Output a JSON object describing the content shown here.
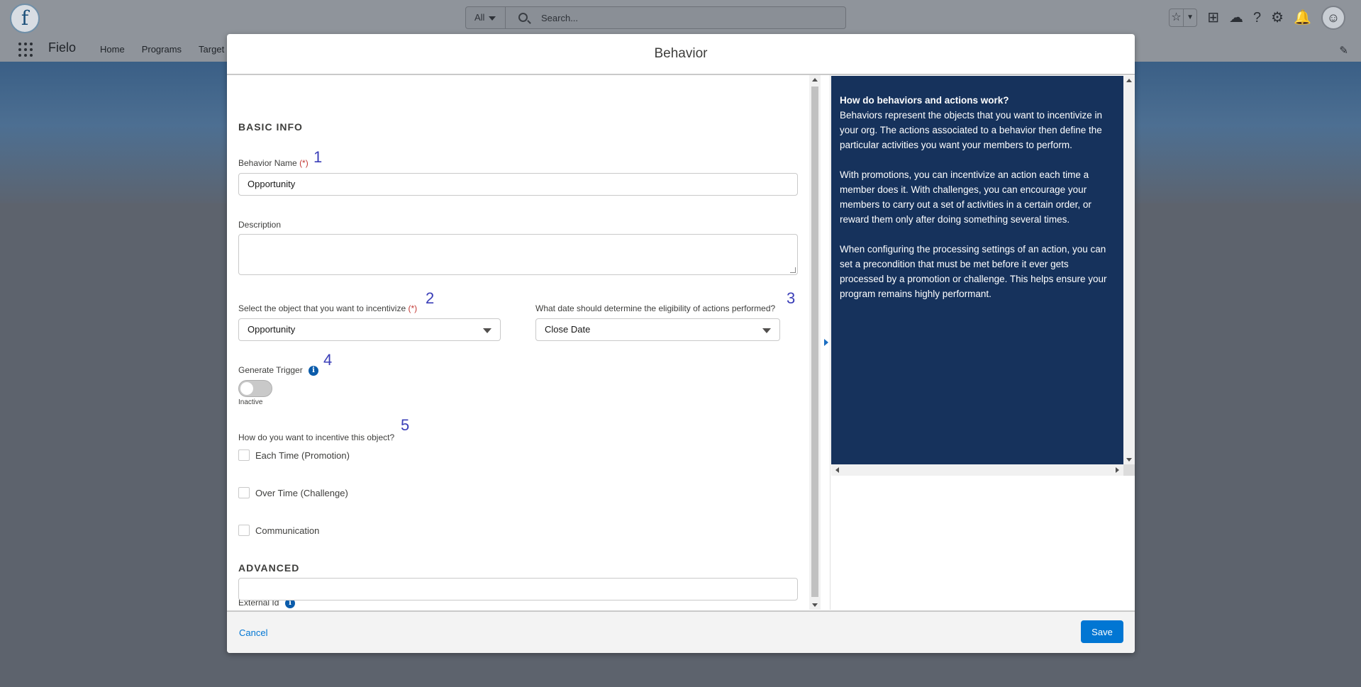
{
  "global_header": {
    "search_scope": "All",
    "search_placeholder": "Search...",
    "app_name": "Fielo",
    "nav_items": [
      "Home",
      "Programs",
      "Target"
    ]
  },
  "modal": {
    "title": "Behavior",
    "basic_info_title": "BASIC INFO",
    "behavior_name_label": "Behavior Name",
    "required_marker": "(*)",
    "behavior_name_value": "Opportunity",
    "description_label": "Description",
    "object_label": "Select the object that you want to incentivize",
    "object_value": "Opportunity",
    "date_label": "What date should determine the eligibility of actions performed?",
    "date_value": "Close Date",
    "generate_trigger_label": "Generate Trigger",
    "toggle_state_label": "Inactive",
    "incentive_label": "How do you want to incentive this object?",
    "options": [
      "Each Time (Promotion)",
      "Over Time (Challenge)",
      "Communication"
    ],
    "advanced_title": "ADVANCED",
    "external_id_label": "External Id",
    "external_id_value": "",
    "annotation_numbers": [
      "1",
      "2",
      "3",
      "4",
      "5"
    ],
    "cancel_label": "Cancel",
    "save_label": "Save"
  },
  "help": {
    "heading": "How do behaviors and actions work?",
    "paragraph_1": "Behaviors represent the objects that you want to incentivize in your org. The actions associated to a behavior then define the particular activities you want your members to perform.",
    "paragraph_2": "With promotions, you can incentivize an action each time a member does it. With challenges, you can encourage your members to carry out a set of activities in a certain order, or reward them only after doing something several times.",
    "paragraph_3": "When configuring the processing settings of an action, you can set a precondition that must be met before it ever gets processed by a promotion or challenge. This helps ensure your program remains highly performant."
  },
  "icons": {
    "logo": "fielo-f-logo",
    "info": "info-icon",
    "app_launcher": "waffle-icon"
  },
  "colors": {
    "help_panel_bg": "#16325c",
    "brand_button": "#0176d3",
    "annotation_number": "#3b3fb8",
    "required": "#c23934"
  }
}
